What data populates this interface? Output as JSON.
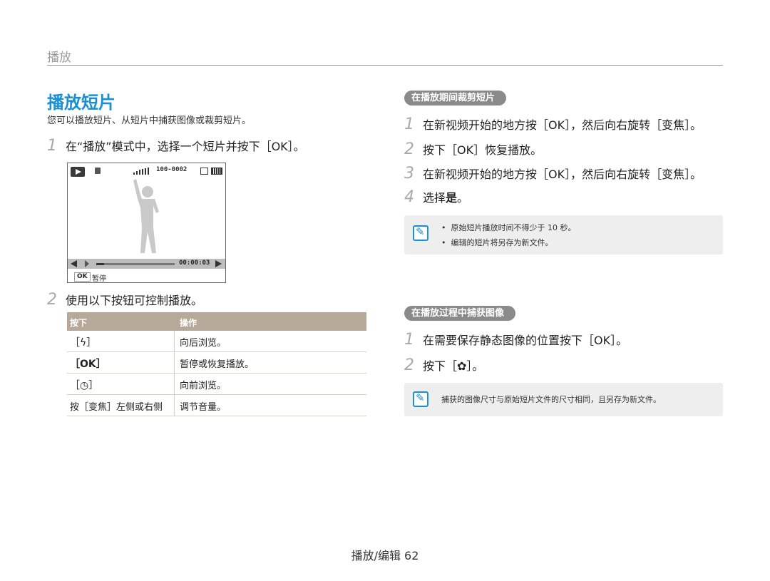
{
  "header": {
    "section": "播放"
  },
  "left": {
    "title": "播放短片",
    "intro": "您可以播放短片、从短片中捕获图像或裁剪短片。",
    "step1": {
      "num": "1",
      "text": "在“播放”模式中，选择一个短片并按下［OK］。"
    },
    "screen": {
      "file_no": "100-0002",
      "time": "00:00:03",
      "ok_key": "OK",
      "ok_label": "暂停",
      "progress": 0.1
    },
    "step2": {
      "num": "2",
      "text": "使用以下按钮可控制播放。"
    },
    "table": {
      "headers": [
        "按下",
        "操作"
      ],
      "rows": [
        {
          "key": "［ϟ］",
          "action": "向后浏览。"
        },
        {
          "key": "［OK］",
          "action": "暂停或恢复播放。"
        },
        {
          "key": "［◷］",
          "action": "向前浏览。"
        },
        {
          "key": "按［变焦］左侧或右侧",
          "action": "调节音量。"
        }
      ]
    }
  },
  "right": {
    "trim": {
      "pill": "在播放期间裁剪短片",
      "steps": [
        {
          "num": "1",
          "text": "在新视频开始的地方按［OK］，然后向右旋转［变焦］。"
        },
        {
          "num": "2",
          "text": "按下［OK］恢复播放。"
        },
        {
          "num": "3",
          "text": "在新视频开始的地方按［OK］，然后向右旋转［变焦］。"
        },
        {
          "num": "4",
          "text_pre": "选择",
          "text_bold": "是",
          "text_post": "。"
        }
      ],
      "notes": [
        "原始短片播放时间不得少于 10 秒。",
        "编辑的短片将另存为新文件。"
      ]
    },
    "capture": {
      "pill": "在播放过程中捕获图像",
      "steps": [
        {
          "num": "1",
          "text": "在需要保存静态图像的位置按下［OK］。"
        },
        {
          "num": "2",
          "text": "按下［✿］。"
        }
      ],
      "note": "捕获的图像尺寸与原始短片文件的尺寸相同，且另存为新文件。"
    }
  },
  "footer": {
    "text": "播放/编辑 62"
  },
  "colors": {
    "accent": "#1b8fd3",
    "table_head": "#b6a99a",
    "pill": "#8a8a8a",
    "note_bg": "#eeeeee"
  },
  "icons": [
    "play-mode-icon",
    "memory-icon",
    "signal-icon",
    "display-icon",
    "battery-icon",
    "rewind-icon",
    "fast-forward-icon",
    "note-icon"
  ]
}
